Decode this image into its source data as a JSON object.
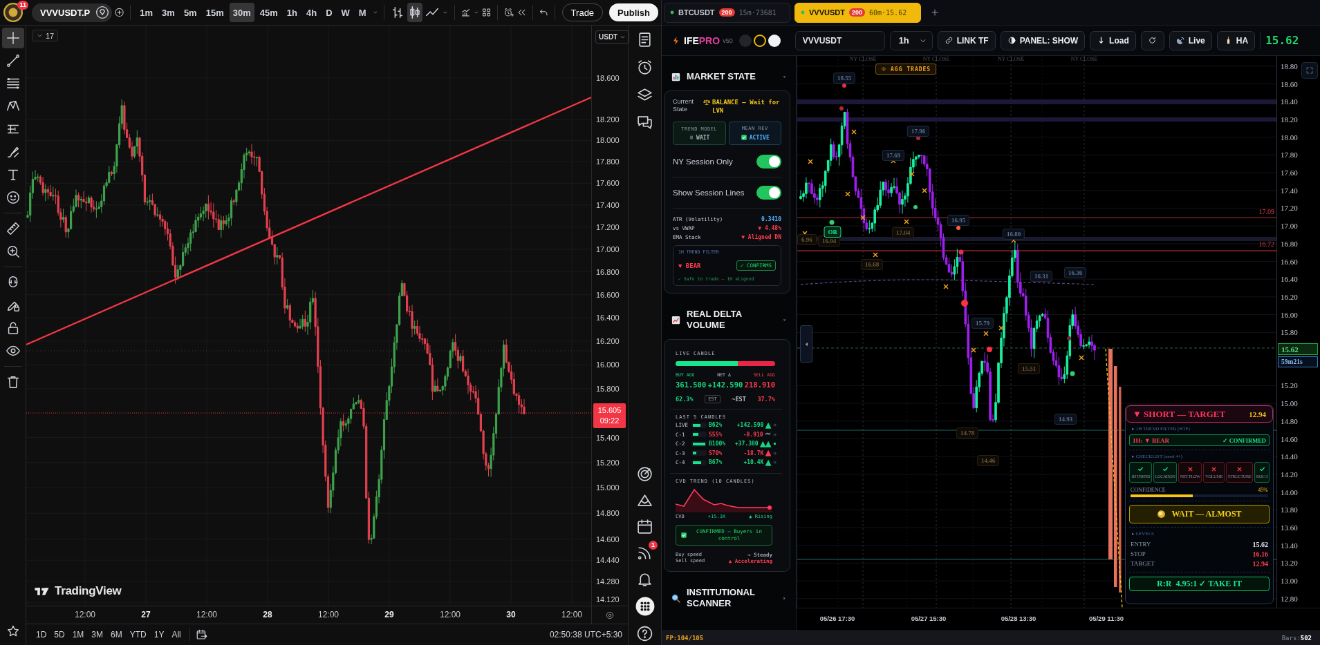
{
  "tradingview": {
    "header": {
      "avatar_badge": "11",
      "symbol": "VVVUSDT.P",
      "intervals": [
        {
          "label": "1m",
          "selected": false
        },
        {
          "label": "3m",
          "selected": false
        },
        {
          "label": "5m",
          "selected": false
        },
        {
          "label": "15m",
          "selected": false
        },
        {
          "label": "30m",
          "selected": true
        },
        {
          "label": "45m",
          "selected": false
        },
        {
          "label": "1h",
          "selected": false
        },
        {
          "label": "4h",
          "selected": false
        },
        {
          "label": "D",
          "selected": false
        },
        {
          "label": "W",
          "selected": false
        },
        {
          "label": "M",
          "selected": false
        }
      ],
      "chart_styles": [
        {
          "kind": "bars",
          "selected": false
        },
        {
          "kind": "candles",
          "selected": true
        },
        {
          "kind": "line",
          "selected": false
        }
      ],
      "trade_button": "Trade",
      "publish_button": "Publish"
    },
    "drawing_tools": [
      [
        {
          "kind": "crosshair",
          "selected": true
        },
        {
          "kind": "trendline",
          "selected": false
        },
        {
          "kind": "fib",
          "selected": false
        },
        {
          "kind": "pattern",
          "selected": false
        },
        {
          "kind": "projection",
          "selected": false
        },
        {
          "kind": "brush",
          "selected": false
        },
        {
          "kind": "text",
          "selected": false
        },
        {
          "kind": "emoji",
          "selected": false
        }
      ],
      [
        {
          "kind": "ruler",
          "selected": false
        },
        {
          "kind": "zoom",
          "selected": false
        }
      ],
      [
        {
          "kind": "magnet",
          "selected": false
        },
        {
          "kind": "drawlock",
          "selected": false
        },
        {
          "kind": "lock",
          "selected": false
        },
        {
          "kind": "eye",
          "selected": false
        }
      ],
      [
        {
          "kind": "trash",
          "selected": false
        }
      ]
    ],
    "chart": {
      "indicators_count": "17",
      "currency": "USDT",
      "price_ticks": [
        "18.600",
        "18.200",
        "18.000",
        "17.800",
        "17.600",
        "17.400",
        "17.200",
        "17.000",
        "16.800",
        "16.600",
        "16.400",
        "16.200",
        "16.000",
        "15.800",
        "15.400",
        "15.200",
        "15.000",
        "14.800",
        "14.600",
        "14.440",
        "14.280",
        "14.120"
      ],
      "last_price": "15.605",
      "countdown": "09:22",
      "time_labels": [
        {
          "label": "12:00",
          "major": false
        },
        {
          "label": "27",
          "major": true
        },
        {
          "label": "12:00",
          "major": false
        },
        {
          "label": "28",
          "major": true
        },
        {
          "label": "12:00",
          "major": false
        },
        {
          "label": "29",
          "major": true
        },
        {
          "label": "12:00",
          "major": false
        },
        {
          "label": "30",
          "major": true
        },
        {
          "label": "12:00",
          "major": false
        }
      ],
      "logo": "TradingView"
    },
    "ranges": [
      "1D",
      "5D",
      "1M",
      "3M",
      "6M",
      "YTD",
      "1Y",
      "All"
    ],
    "clock": "02:50:38 UTC+5:30",
    "side_icons": [
      [
        {
          "kind": "watchlist"
        },
        {
          "kind": "alerts"
        },
        {
          "kind": "layers"
        },
        {
          "kind": "chat"
        }
      ],
      [
        {
          "kind": "target"
        },
        {
          "kind": "ideas"
        },
        {
          "kind": "calendar"
        },
        {
          "kind": "signals",
          "badge": "1"
        },
        {
          "kind": "bell"
        },
        {
          "kind": "apps"
        },
        {
          "kind": "help"
        }
      ]
    ]
  },
  "ifepro": {
    "tabs": [
      {
        "symbol": "BTCUSDT",
        "count": "200",
        "info": "15m·73681",
        "selected": false
      },
      {
        "symbol": "VVVUSDT",
        "count": "200",
        "info": "60m·15.62",
        "selected": true
      }
    ],
    "toolbar": {
      "brand": "IFE",
      "brand_accent": "PRO",
      "version": "v50",
      "themes": [
        {
          "color": "#24252c",
          "selected": false
        },
        {
          "color": "#0b0b0d",
          "selected": true
        },
        {
          "color": "#f2f2f4",
          "selected": false
        }
      ],
      "symbol": "VVVUSDT",
      "timeframe": "1h",
      "buttons": [
        {
          "kind": "link",
          "label": "LINK TF"
        },
        {
          "kind": "panel",
          "label": "PANEL: SHOW"
        },
        {
          "kind": "load",
          "label": "Load"
        },
        {
          "kind": "refresh"
        },
        {
          "kind": "live",
          "label": "Live"
        },
        {
          "kind": "ha",
          "label": "HA"
        }
      ],
      "price": "15.62"
    },
    "panel": {
      "market_state": {
        "title": "MARKET STATE",
        "expanded": true,
        "state_label": "Current State",
        "state_value": "BALANCE — Wait for LVN",
        "trend_model": {
          "label": "TREND MODEL",
          "value": "WAIT"
        },
        "mean_rev": {
          "label": "MEAN REV",
          "value": "ACTIVE",
          "checked": true
        },
        "toggles": [
          {
            "label": "NY Session Only",
            "on": true
          },
          {
            "label": "Show Session Lines",
            "on": true
          }
        ],
        "stats": [
          {
            "label": "ATR (Volatility)",
            "value": "0.3410",
            "color": "#4fb3ff"
          },
          {
            "label": "vs VWAP",
            "value": "▼ 4.48%",
            "color": "#ff3b4e"
          },
          {
            "label": "EMA Stack",
            "value": "▼ Aligned DN",
            "color": "#ff3b4e"
          }
        ],
        "trend_filter": {
          "title": "1H TREND FILTER",
          "direction": "▼ BEAR",
          "badge": "✓ CONFIRMS",
          "note": "✓ Safe to trade — 1H aligned"
        }
      },
      "delta_volume": {
        "title": "REAL DELTA VOLUME",
        "expanded": true,
        "live_title": "LIVE CANDLE",
        "live_bar": {
          "level": 0.623
        },
        "buy": {
          "label": "BUY AGG",
          "value": "361.500",
          "pct": "62.3%"
        },
        "net": {
          "label": "NET Δ",
          "value": "+142.590"
        },
        "sell": {
          "label": "SELL AGG",
          "value": "218.910",
          "pct": "37.7%"
        },
        "est_badge": "EST",
        "est_text": "~EST",
        "candles_title": "LAST 5 CANDLES",
        "candles": [
          {
            "label": "LIVE",
            "color": "#19d67e",
            "level": 0.62,
            "share": "B62%",
            "delta": "+142.590",
            "trend": {
              "text": "▲",
              "color": "#19d67e"
            },
            "active": false
          },
          {
            "label": "C-1",
            "color": "#ff3b4e",
            "level": 0.45,
            "share": "S55%",
            "delta": "-8.910",
            "trend": {
              "text": "~",
              "color": "#7d8799"
            },
            "active": false
          },
          {
            "label": "C-2",
            "color": "#19d67e",
            "level": 1,
            "share": "B100%",
            "delta": "+37.380",
            "trend": {
              "text": "▲▲",
              "color": "#19d67e"
            },
            "active": true
          },
          {
            "label": "C-3",
            "color": "#ff3b4e",
            "level": 0.3,
            "share": "S70%",
            "delta": "-18.7K",
            "trend": {
              "text": "▲",
              "color": "#ff3b4e"
            },
            "active": false
          },
          {
            "label": "C-4",
            "color": "#19d67e",
            "level": 0.67,
            "share": "B67%",
            "delta": "+10.4K",
            "trend": {
              "text": "▲",
              "color": "#19d67e"
            },
            "active": false
          }
        ],
        "cvd": {
          "title": "CVD TREND (10 CANDLES)",
          "label": "CVD",
          "value": "+15.1K",
          "trend": "▲ Rising"
        },
        "confirm": {
          "checked": true,
          "text": "CONFIRMED — Buyers in control"
        },
        "speeds": [
          {
            "label": "Buy speed",
            "value": "→ Steady",
            "color": "#9aa6b8"
          },
          {
            "label": "Sell speed",
            "value": "▲ Accelerating",
            "color": "#ff3b4e"
          }
        ]
      },
      "scanner": {
        "title": "INSTITUTIONAL SCANNER",
        "expanded": false
      }
    },
    "chart": {
      "badge": "AGG TRADES",
      "session_labels": [
        "NY CLOSE",
        "NY CLOSE",
        "NY CLOSE",
        "NY CLOSE"
      ],
      "price_ticks": [
        "18.80",
        "18.60",
        "18.40",
        "18.20",
        "18.00",
        "17.80",
        "17.60",
        "17.40",
        "17.20",
        "17.00",
        "16.80",
        "16.60",
        "16.40",
        "16.20",
        "16.00",
        "15.80",
        "15.20",
        "15.00",
        "14.80",
        "14.60",
        "14.40",
        "14.20",
        "14.00",
        "13.80",
        "13.60",
        "13.40",
        "13.20",
        "13.00",
        "12.80"
      ],
      "levels": [
        "17.09",
        "16.72"
      ],
      "tags": [
        {
          "text": "18.55",
          "kind": "pivot"
        },
        {
          "text": "17.96",
          "kind": "pivot"
        },
        {
          "text": "17.69",
          "kind": "pivot"
        },
        {
          "text": "16.95",
          "kind": "pivot"
        },
        {
          "text": "16.80",
          "kind": "pivot"
        },
        {
          "text": "16.31",
          "kind": "pivot"
        },
        {
          "text": "16.36",
          "kind": "pivot"
        },
        {
          "text": "15.79",
          "kind": "pivot"
        },
        {
          "text": "14.93",
          "kind": "pivot"
        },
        {
          "text": "17.04",
          "kind": "support"
        },
        {
          "text": "6.96",
          "kind": "support"
        },
        {
          "text": "16.94",
          "kind": "support"
        },
        {
          "text": "16.68",
          "kind": "support"
        },
        {
          "text": "15.51",
          "kind": "support"
        },
        {
          "text": "14.78",
          "kind": "support"
        },
        {
          "text": "14.46",
          "kind": "support"
        },
        {
          "text": "OB",
          "kind": "block"
        }
      ],
      "last_price": "15.62",
      "countdown": "59m21s",
      "dates": [
        "05/26 17:30",
        "05/27 15:30",
        "05/28 13:30",
        "05/29 11:30"
      ]
    },
    "signal": {
      "direction": "▼ SHORT — TARGET",
      "target": "12.94",
      "filter_title": "▸ 1H TREND FILTER (HTF)",
      "filter_state": "1H: ▼ BEAR",
      "filter_badge": "✓ CONFIRMED",
      "checklist_title": "▸ CHECKLIST (need 4+)",
      "checklist": [
        {
          "label": "1H TREND",
          "checked": true
        },
        {
          "label": "LOCATION",
          "checked": true
        },
        {
          "label": "NET FLOW",
          "checked": false
        },
        {
          "label": "VOLUME",
          "checked": false
        },
        {
          "label": "STRUCTURE",
          "checked": false
        },
        {
          "label": "ROC-3",
          "checked": true
        }
      ],
      "confidence_label": "CONFIDENCE",
      "confidence": "45%",
      "confidence_bar": {
        "level": 0.45
      },
      "verdict": "WAIT — ALMOST",
      "levels_title": "▸ LEVELS",
      "levels": [
        {
          "label": "ENTRY",
          "value": "15.62",
          "color": "#e6e8f0"
        },
        {
          "label": "STOP",
          "value": "16.16",
          "color": "#ff4050"
        },
        {
          "label": "TARGET",
          "value": "12.94",
          "color": "#ff4050"
        }
      ],
      "rr": "R:R  4.95:1 ✓ TAKE IT"
    },
    "status": {
      "fp": "FP:104/105",
      "bars_label": "Bars:",
      "bars": "502"
    }
  }
}
